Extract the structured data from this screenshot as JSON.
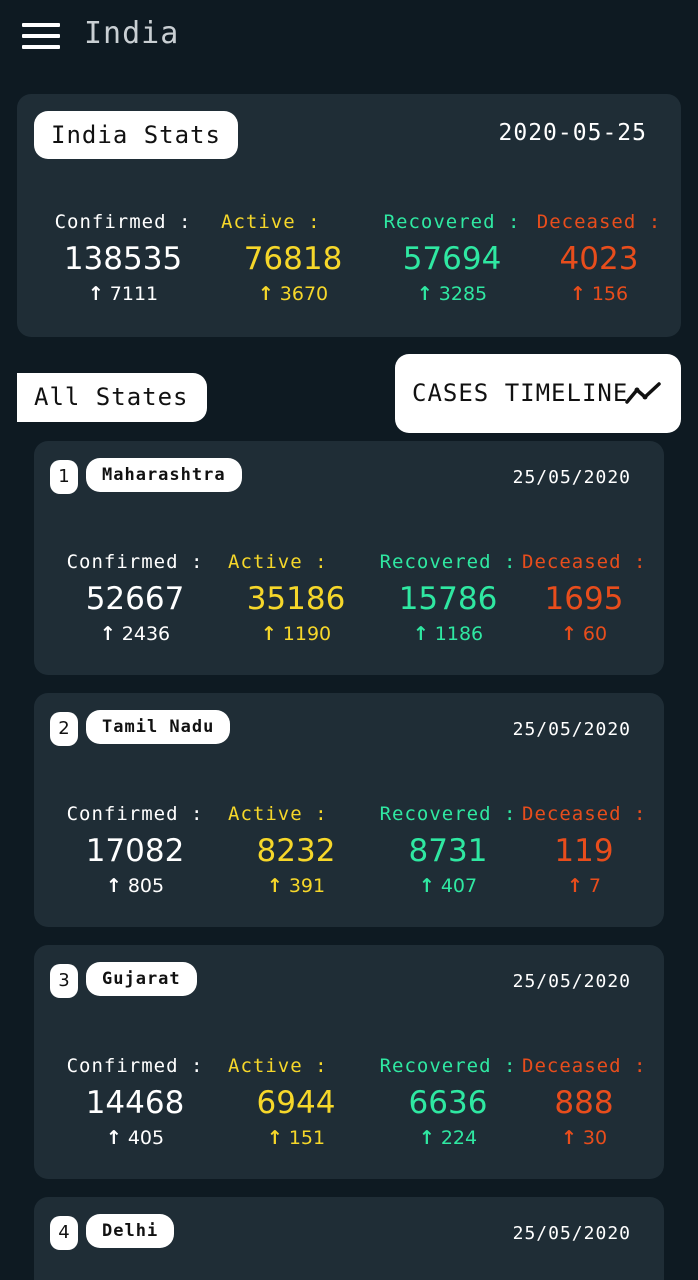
{
  "header": {
    "title": "India"
  },
  "india_stats": {
    "title": "India Stats",
    "date": "2020-05-25",
    "confirmed": {
      "label": "Confirmed :",
      "value": "138535",
      "delta": "7111"
    },
    "active": {
      "label": "Active :",
      "value": "76818",
      "delta": "3670"
    },
    "recovered": {
      "label": "Recovered :",
      "value": "57694",
      "delta": "3285"
    },
    "deceased": {
      "label": "Deceased :",
      "value": "4023",
      "delta": "156"
    }
  },
  "section": {
    "all_states_label": "All States",
    "timeline_label": "CASES TIMELINE"
  },
  "states": [
    {
      "rank": "1",
      "name": "Maharashtra",
      "date": "25/05/2020",
      "confirmed": {
        "label": "Confirmed :",
        "value": "52667",
        "delta": "2436"
      },
      "active": {
        "label": "Active :",
        "value": "35186",
        "delta": "1190"
      },
      "recovered": {
        "label": "Recovered :",
        "value": "15786",
        "delta": "1186"
      },
      "deceased": {
        "label": "Deceased :",
        "value": "1695",
        "delta": "60"
      }
    },
    {
      "rank": "2",
      "name": "Tamil Nadu",
      "date": "25/05/2020",
      "confirmed": {
        "label": "Confirmed :",
        "value": "17082",
        "delta": "805"
      },
      "active": {
        "label": "Active :",
        "value": "8232",
        "delta": "391"
      },
      "recovered": {
        "label": "Recovered :",
        "value": "8731",
        "delta": "407"
      },
      "deceased": {
        "label": "Deceased :",
        "value": "119",
        "delta": "7"
      }
    },
    {
      "rank": "3",
      "name": "Gujarat",
      "date": "25/05/2020",
      "confirmed": {
        "label": "Confirmed :",
        "value": "14468",
        "delta": "405"
      },
      "active": {
        "label": "Active :",
        "value": "6944",
        "delta": "151"
      },
      "recovered": {
        "label": "Recovered :",
        "value": "6636",
        "delta": "224"
      },
      "deceased": {
        "label": "Deceased :",
        "value": "888",
        "delta": "30"
      }
    },
    {
      "rank": "4",
      "name": "Delhi",
      "date": "25/05/2020"
    }
  ],
  "colors": {
    "background": "#0e1a22",
    "card": "#1f2d36",
    "confirmed": "#ffffff",
    "active": "#f6d72a",
    "recovered": "#2fe8a2",
    "deceased": "#e84d1c"
  },
  "icons": {
    "menu": "hamburger-menu-icon",
    "timeline": "trend-line-icon",
    "delta": "arrow-up-icon"
  }
}
